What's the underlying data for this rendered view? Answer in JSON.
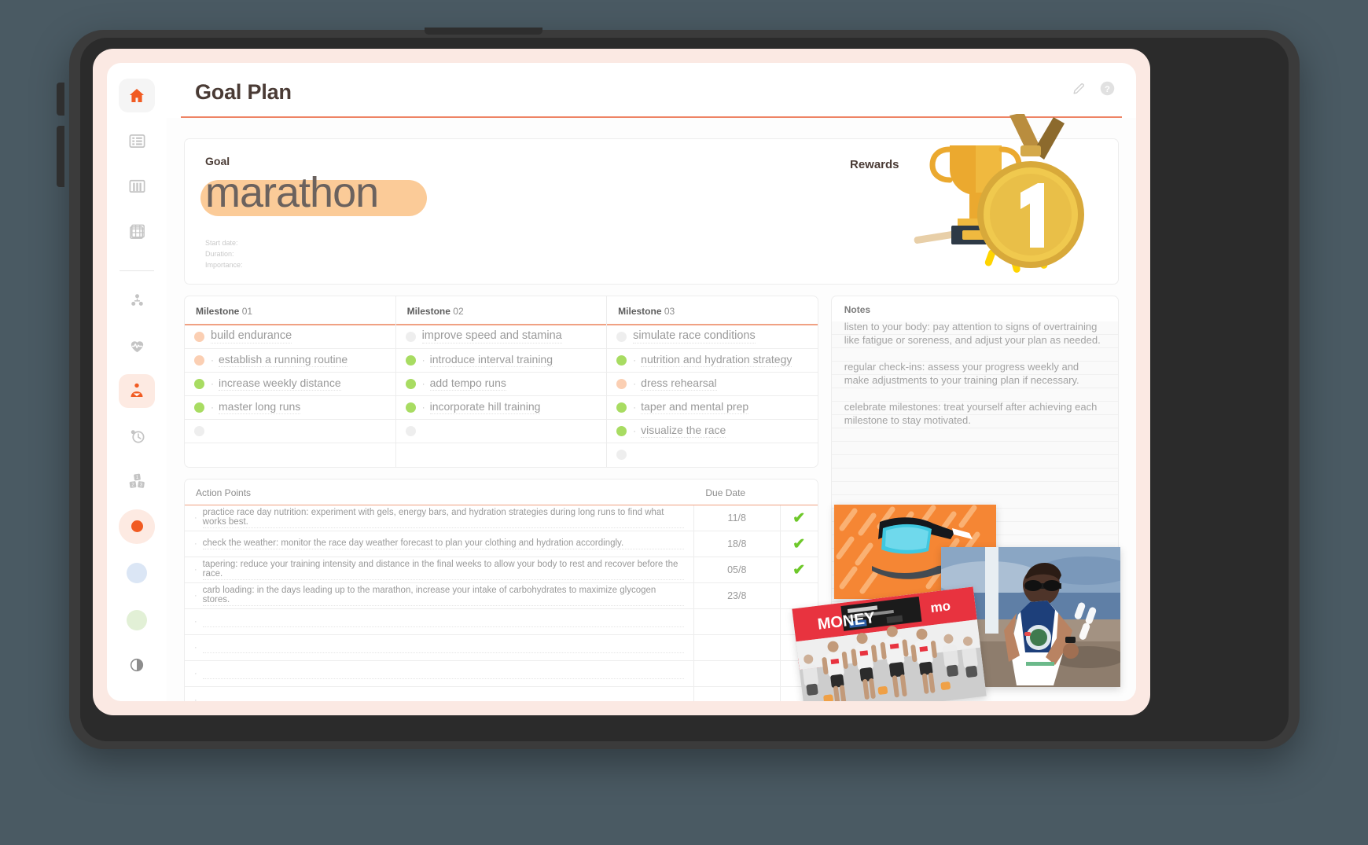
{
  "app": {
    "header": {
      "title": "Goal Plan",
      "edit_icon": "pencil-icon",
      "help_icon": "help-circle-icon"
    }
  },
  "sidebar": {
    "items": [
      {
        "name": "home",
        "icon": "home-icon",
        "active": true
      },
      {
        "name": "list",
        "icon": "list-icon",
        "active": false
      },
      {
        "name": "board",
        "icon": "columns-icon",
        "active": false
      },
      {
        "name": "grid",
        "icon": "grid-icon",
        "active": false
      },
      {
        "name": "team",
        "icon": "org-chart-icon",
        "active": false
      },
      {
        "name": "health",
        "icon": "heartbeat-icon",
        "active": false
      },
      {
        "name": "goals",
        "icon": "goal-person-icon",
        "active": true
      },
      {
        "name": "history",
        "icon": "history-icon",
        "active": false
      },
      {
        "name": "blocks",
        "icon": "number-blocks-icon",
        "active": false
      }
    ],
    "swatches": [
      {
        "name": "orange",
        "color": "#f15b22",
        "selected": true
      },
      {
        "name": "blue",
        "color": "#dbe6f5",
        "selected": false
      },
      {
        "name": "green",
        "color": "#e2f0d6",
        "selected": false
      }
    ],
    "theme_toggle_icon": "contrast-icon"
  },
  "goal_card": {
    "label": "Goal",
    "value": "marathon",
    "highlight_color": "#fbcb98",
    "meta": [
      "Start date:",
      "Duration:",
      "Importance:"
    ],
    "rewards_label": "Rewards",
    "reward_art": "trophy-and-gold-medal-number-one"
  },
  "milestones": {
    "columns": [
      {
        "header_bold": "Milestone",
        "header_num": "01",
        "rows": [
          {
            "dot": "peach",
            "sub": false,
            "text": "build endurance"
          },
          {
            "dot": "peach",
            "sub": true,
            "text": "establish a running routine"
          },
          {
            "dot": "green",
            "sub": true,
            "text": "increase weekly distance"
          },
          {
            "dot": "green",
            "sub": true,
            "text": "master long runs"
          },
          {
            "dot": "gray",
            "sub": false,
            "text": ""
          },
          {
            "dot": "none",
            "sub": false,
            "text": ""
          }
        ]
      },
      {
        "header_bold": "Milestone",
        "header_num": "02",
        "rows": [
          {
            "dot": "gray",
            "sub": false,
            "text": "improve speed and stamina"
          },
          {
            "dot": "green",
            "sub": true,
            "text": "introduce interval training"
          },
          {
            "dot": "green",
            "sub": true,
            "text": "add tempo runs"
          },
          {
            "dot": "green",
            "sub": true,
            "text": "incorporate hill training"
          },
          {
            "dot": "gray",
            "sub": false,
            "text": ""
          },
          {
            "dot": "none",
            "sub": false,
            "text": ""
          }
        ]
      },
      {
        "header_bold": "Milestone",
        "header_num": "03",
        "rows": [
          {
            "dot": "gray",
            "sub": false,
            "text": "simulate race conditions"
          },
          {
            "dot": "green",
            "sub": true,
            "text": "nutrition and hydration strategy"
          },
          {
            "dot": "peach",
            "sub": true,
            "text": "dress rehearsal"
          },
          {
            "dot": "green",
            "sub": true,
            "text": "taper and mental prep"
          },
          {
            "dot": "green",
            "sub": true,
            "text": "visualize the race"
          },
          {
            "dot": "gray",
            "sub": false,
            "text": ""
          }
        ]
      }
    ]
  },
  "action_points": {
    "col_header_task": "Action Points",
    "col_header_due": "Due Date",
    "check_glyph": "✔",
    "rows": [
      {
        "text": "practice race day nutrition: experiment with gels, energy bars, and hydration strategies during long runs to find what works best.",
        "due": "11/8",
        "done": true
      },
      {
        "text": "check the weather: monitor the race day weather forecast to plan your clothing and hydration accordingly.",
        "due": "18/8",
        "done": true
      },
      {
        "text": "tapering: reduce your training intensity and distance in the final weeks to allow your body to rest and recover before the race.",
        "due": "05/8",
        "done": true
      },
      {
        "text": "carb loading: in the days leading up to the marathon, increase your intake of carbohydrates to maximize glycogen stores.",
        "due": "23/8",
        "done": false
      },
      {
        "text": "",
        "due": "",
        "done": false
      },
      {
        "text": "",
        "due": "",
        "done": false
      },
      {
        "text": "",
        "due": "",
        "done": false
      },
      {
        "text": "",
        "due": "",
        "done": false
      }
    ]
  },
  "notes": {
    "title": "Notes",
    "paragraphs": [
      "listen to your body: pay attention to signs of overtraining like fatigue or soreness, and adjust your plan as needed.",
      "regular check-ins: assess your progress weekly and make adjustments to your training plan if necessary.",
      "celebrate milestones: treat yourself after achieving each milestone to stay motivated."
    ]
  },
  "photos": [
    {
      "name": "sunglasses-photo",
      "caption": ""
    },
    {
      "name": "race-crowd-photo",
      "caption": "MONEY"
    },
    {
      "name": "runner-photo",
      "caption": ""
    }
  ],
  "colors": {
    "accent": "#ee8465",
    "screen_bg": "#fbe9e3",
    "dot_green": "#a8dc62",
    "dot_peach": "#fbcfb3",
    "check_green": "#6ec82a"
  }
}
